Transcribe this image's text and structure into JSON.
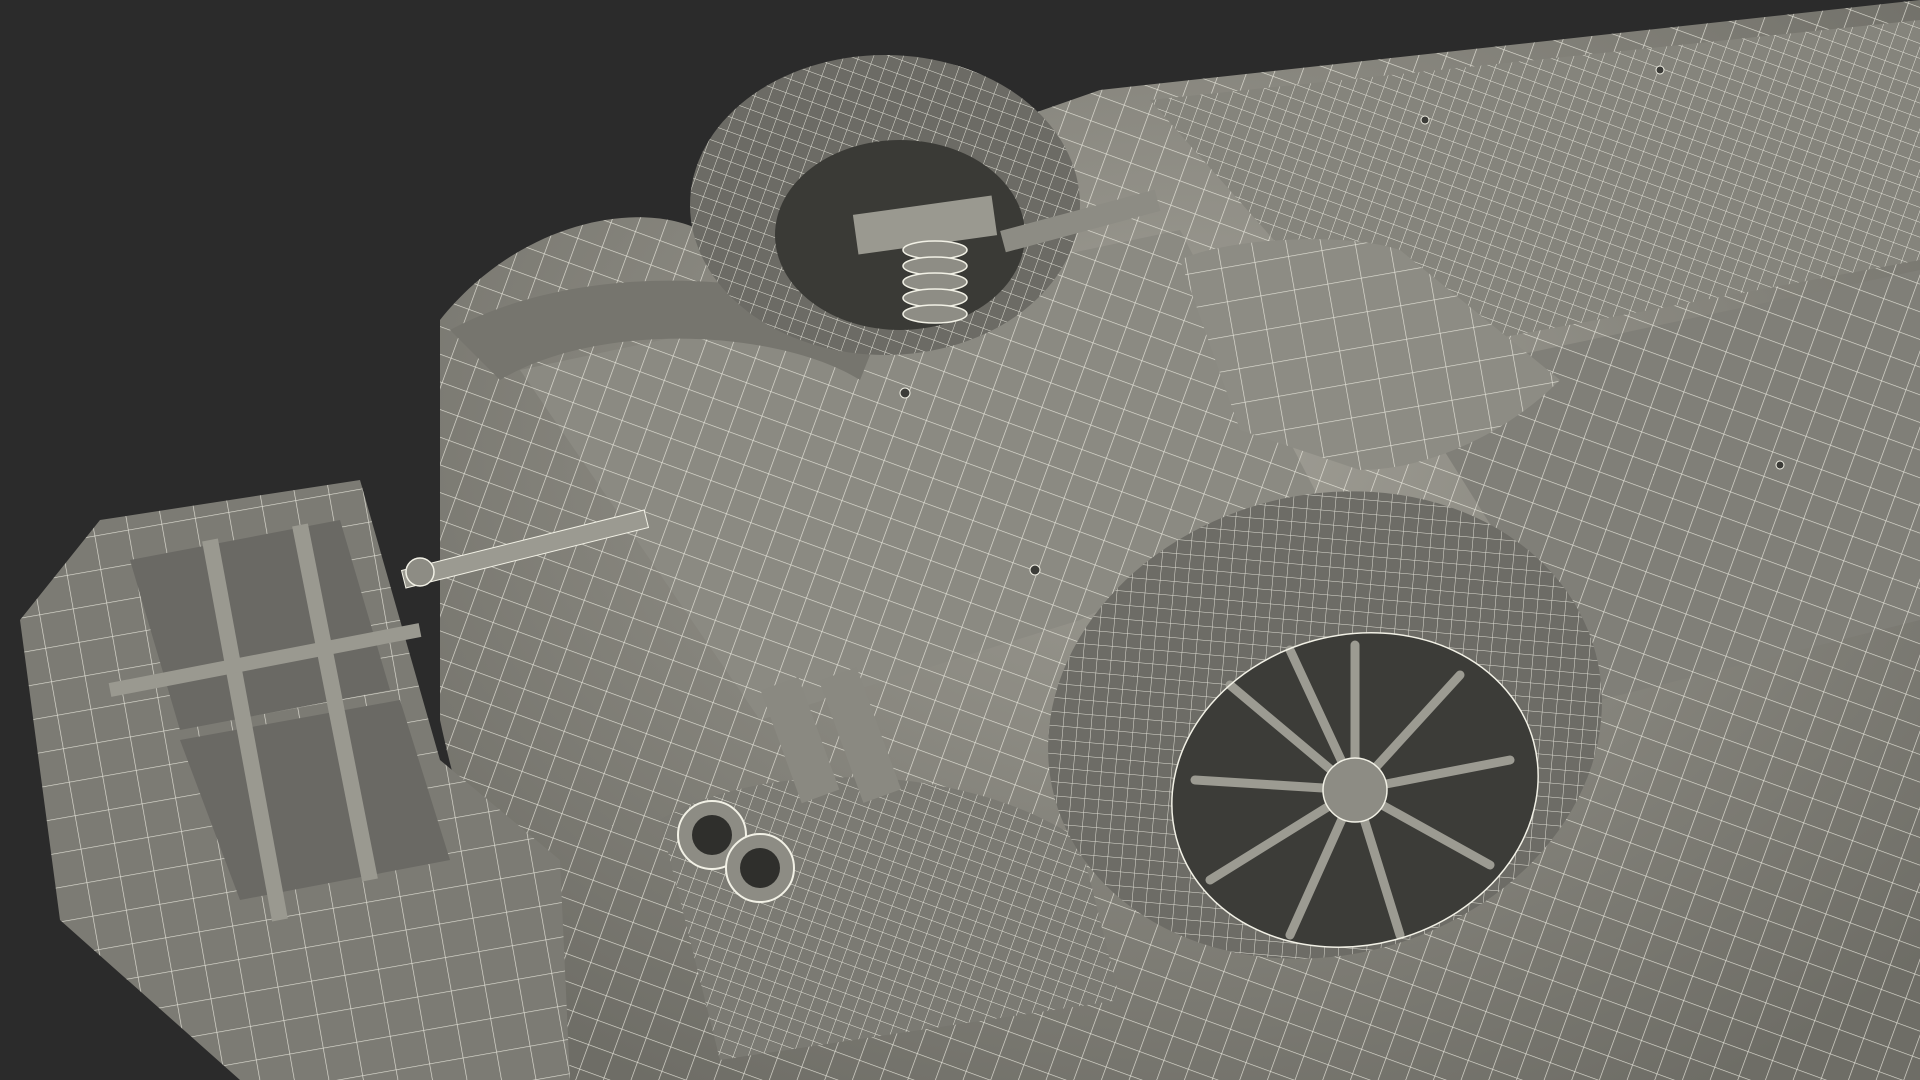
{
  "scene": {
    "subject": "car-underside-wireframe-render",
    "background_color": "#2b2b2b",
    "surface_color": "#8f8f86",
    "surface_shadow_color": "#5f5f58",
    "surface_dark_color": "#3c3c38",
    "wire_color": "#f2f1e6",
    "icons": [
      "tire",
      "suspension-spring",
      "exhaust-tips",
      "wheel-rim",
      "underbody-panel",
      "trailer-hitch",
      "cargo-box"
    ]
  }
}
